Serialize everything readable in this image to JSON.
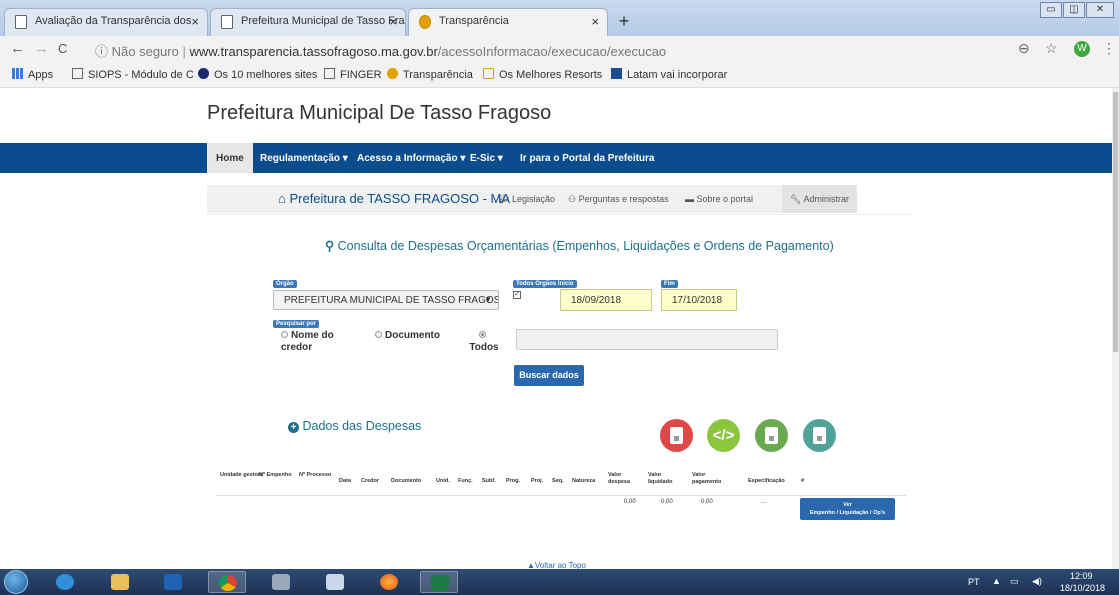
{
  "browser": {
    "tabs": [
      {
        "title": "Avaliação da Transparência dos"
      },
      {
        "title": "Prefeitura Municipal de Tasso Fra"
      },
      {
        "title": "Transparência"
      }
    ],
    "address": {
      "security": "Não seguro",
      "domain": "www.transparencia.tassofragoso.ma.gov.br",
      "path": "/acessoInformacao/execucao/execucao"
    },
    "bookmarks": [
      "Apps",
      "SIOPS - Módulo de C",
      "Os 10 melhores sites",
      "FINGER",
      "Transparência",
      "Os Melhores Resorts",
      "Latam vai incorporar"
    ]
  },
  "site": {
    "title": "Prefeitura Municipal De Tasso Fragoso",
    "nav": [
      "Home",
      "Regulamentação",
      "Acesso a Informação",
      "E-Sic",
      "Ir para o Portal da Prefeitura"
    ],
    "subnav": {
      "brand": "Prefeitura de TASSO FRAGOSO - MA",
      "items": [
        "Legislação",
        "Perguntas e respostas",
        "Sobre o portal",
        "Administrar"
      ]
    }
  },
  "form": {
    "title": "Consulta de Despesas Orçamentárias (Empenhos, Liquidações e Ordens de Pagamento)",
    "orgao_label": "Orgão",
    "orgao_value": "PREFEITURA MUNICIPAL DE TASSO FRAGOS(",
    "todos_label": "Todos Orgãos",
    "inicio_label": "Inicio",
    "inicio_value": "18/09/2018",
    "fim_label": "Fim",
    "fim_value": "17/10/2018",
    "pesquisar_label": "Pesquisar por",
    "options": [
      "Nome do credor",
      "Documento",
      "Todos"
    ],
    "selected_option": "Todos",
    "search_placeholder": "",
    "button": "Buscar dados"
  },
  "results": {
    "title": "Dados das Despesas",
    "export_icons": [
      "pdf-icon",
      "code-icon",
      "xls-icon",
      "json-icon"
    ],
    "export_colors": [
      "#e04848",
      "#8cc63e",
      "#6aaa4e",
      "#4fa39b"
    ],
    "columns": [
      "Unidade gestora",
      "Nº Empenho",
      "Nº Processo",
      "Data",
      "Credor",
      "Documento",
      "Unid.",
      "Funç.",
      "Subf.",
      "Prog.",
      "Proj.",
      "Seq.",
      "Natureza",
      "Valor despesa",
      "Valor liquidado",
      "Valor pagamento",
      "Especificação",
      "#"
    ],
    "row": {
      "valor_despesa": "0,00",
      "valor_liquidado": "0,00",
      "valor_pagamento": "0,00",
      "especificacao": "...",
      "button_line1": "Ver",
      "button_line2": "Empenho / Liquidação / Op's"
    },
    "back_to_top": "Voltar ao Topo"
  },
  "taskbar": {
    "lang": "PT",
    "time": "12:09",
    "date": "18/10/2018"
  }
}
